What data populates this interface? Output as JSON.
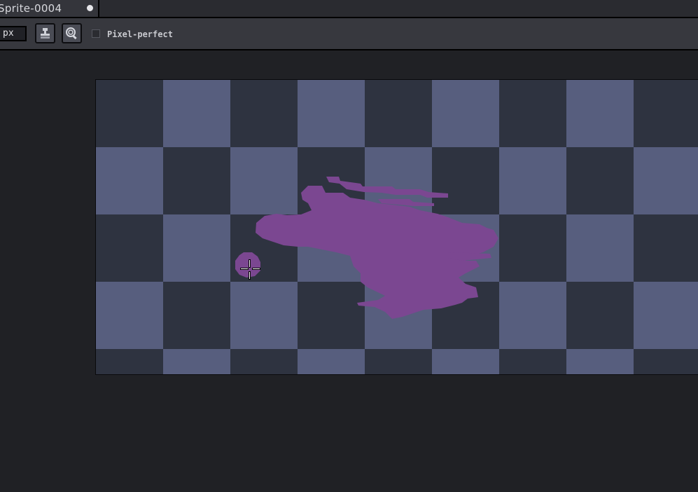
{
  "tab": {
    "title": "Sprite-0004"
  },
  "context_bar": {
    "size_value": "px",
    "pixel_perfect_label": "Pixel-perfect",
    "pixel_perfect_checked": false
  },
  "canvas": {
    "checker_light": "#575e7e",
    "checker_dark": "#2e3340",
    "paint_color": "#7b4791"
  },
  "icons": {
    "tool_button_1": "stamp-icon",
    "tool_button_2": "zoom-lens-icon",
    "cursor": "crosshair-cursor-icon"
  }
}
